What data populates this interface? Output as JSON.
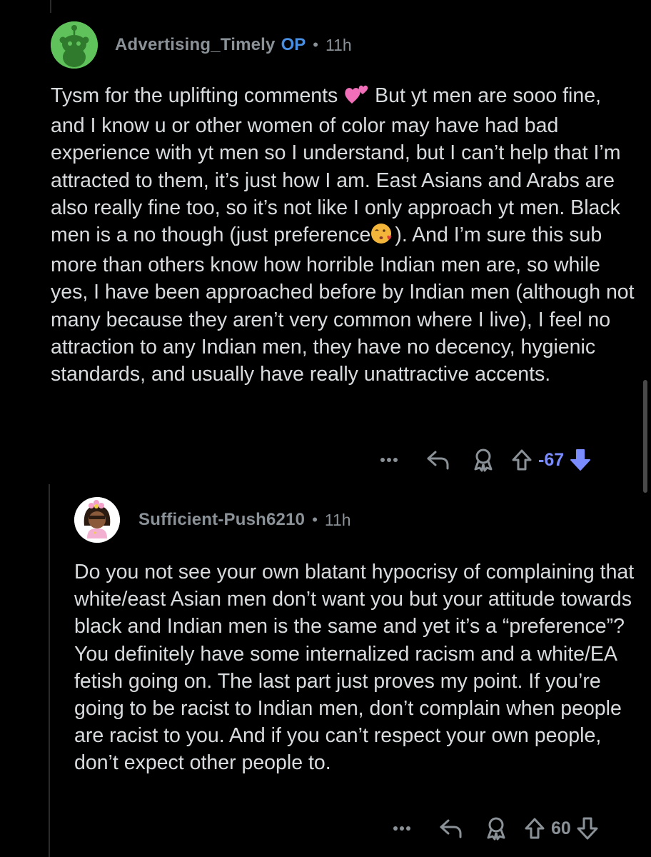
{
  "colors": {
    "background": "#000000",
    "text": "#d9dcde",
    "meta": "#8a9197",
    "op_badge": "#4a90e2",
    "downvoted": "#7b8cff",
    "avatar_green": "#5fc25a"
  },
  "comments": [
    {
      "username": "Advertising_Timely",
      "badge": "OP",
      "separator": "•",
      "time": "11h",
      "body": [
        {
          "text": "Tysm for the uplifting comments "
        },
        {
          "emoji": "two-hearts-emoji"
        },
        {
          "text": "  But yt men are sooo fine, and I know u or other women of color may have had bad experience with yt men so I understand, but I can’t help that I’m attracted to them, it’s just how I am. East Asians and Arabs are also really fine too, so it’s not like I only approach yt men. Black men is a no though (just preference"
        },
        {
          "emoji": "kissing-heart-emoji"
        },
        {
          "text": "). And I’m sure this sub more than others know how horrible Indian men are, so while yes, I have been approached before by Indian men (although not many because they aren’t very common where I live), I feel no attraction to any Indian men, they have no decency, hygienic standards, and usually have really unattractive accents."
        }
      ],
      "actions": {
        "more": "more-options-icon",
        "reply": "reply-icon",
        "award": "award-icon",
        "upvote": "upvote-icon",
        "score": "-67",
        "downvote": "downvote-icon"
      }
    },
    {
      "username": "Sufficient-Push6210",
      "separator": "•",
      "time": "11h",
      "body": [
        {
          "text": "Do you not see your own blatant hypocrisy of complaining that white/east Asian men don’t want you but your attitude towards black and Indian men is the same and yet it’s a “preference”? You definitely have some internalized racism and a white/EA fetish going on. The last part just proves my point. If you’re going to be racist to Indian men, don’t complain when people are racist to you. And if you can’t respect your own people, don’t expect other people to."
        }
      ],
      "actions": {
        "more": "more-options-icon",
        "reply": "reply-icon",
        "award": "award-icon",
        "upvote": "upvote-icon",
        "score": "60",
        "downvote": "downvote-icon"
      }
    }
  ]
}
